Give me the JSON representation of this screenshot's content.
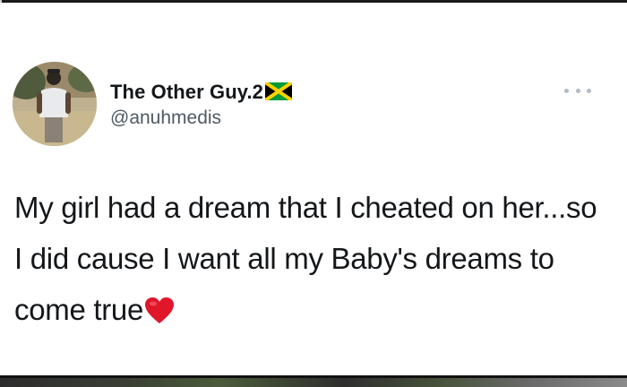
{
  "tweet": {
    "display_name": "The Other Guy.2",
    "handle": "@anuhmedis",
    "text": "My girl had a dream that I cheated on her...so I did cause I want all my Baby's dreams to come true",
    "flag_icon": "jamaica-flag-icon",
    "heart_icon": "red-heart-icon",
    "more_icon": "more-options-icon"
  },
  "colors": {
    "name_text": "#14171a",
    "handle_text": "#4d5a66",
    "heart": "#e0162b",
    "flag_green": "#009b3a",
    "flag_gold": "#fed100",
    "flag_black": "#000000"
  }
}
